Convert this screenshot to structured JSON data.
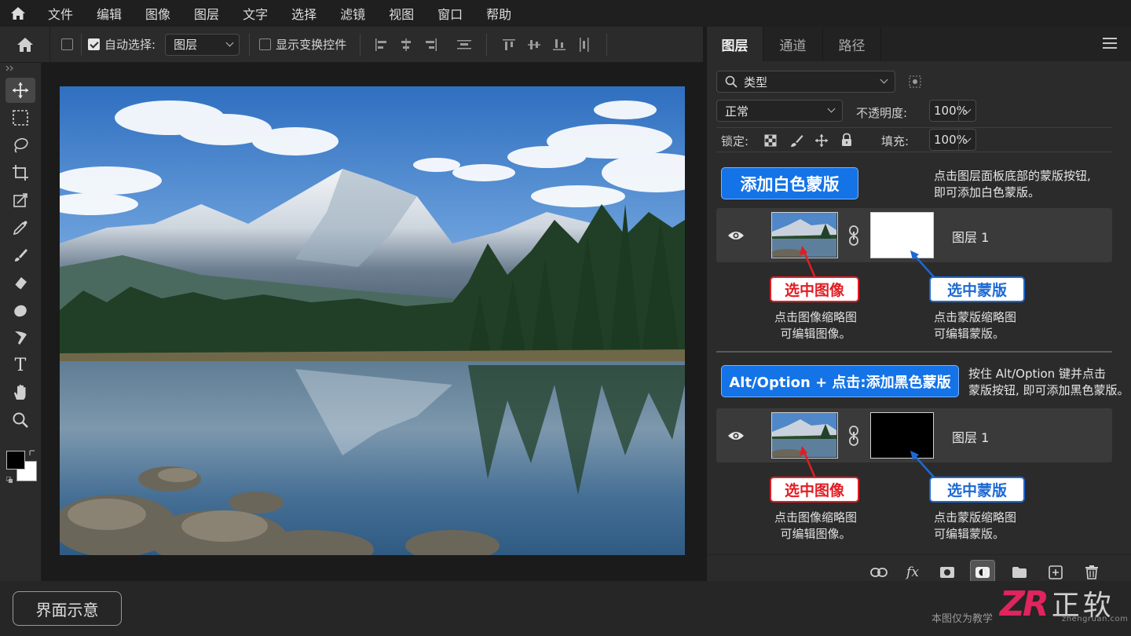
{
  "menu": {
    "items": [
      "文件",
      "编辑",
      "图像",
      "图层",
      "文字",
      "选择",
      "滤镜",
      "视图",
      "窗口",
      "帮助"
    ]
  },
  "options": {
    "auto_select_label": "自动选择:",
    "auto_select_checked": true,
    "target_value": "图层",
    "show_transform_label": "显示变换控件",
    "show_transform_checked": false
  },
  "tools": [
    "move-tool",
    "marquee-tool",
    "lasso-tool",
    "crop-tool",
    "frame-tool",
    "eyedropper-tool",
    "brush-tool",
    "eraser-tool",
    "dodge-tool",
    "pen-tool",
    "type-tool",
    "hand-tool",
    "zoom-tool"
  ],
  "type_tool_glyph": "T",
  "panel": {
    "tabs": [
      "图层",
      "通道",
      "路径"
    ],
    "active_tab": "图层",
    "filter_value": "类型",
    "blend_mode": "正常",
    "opacity_label": "不透明度:",
    "opacity_value": "100%",
    "lock_label": "锁定:",
    "fill_label": "填充:",
    "fill_value": "100%"
  },
  "sections": [
    {
      "banner": "添加白色蒙版",
      "note_line1": "点击图层面板底部的蒙版按钮,",
      "note_line2": "即可添加白色蒙版。",
      "layer_name": "图层 1",
      "mask_color": "#ffffff",
      "tag_image": "选中图像",
      "tag_mask": "选中蒙版",
      "caption_image_1": "点击图像缩略图",
      "caption_image_2": "可编辑图像。",
      "caption_mask_1": "点击蒙版缩略图",
      "caption_mask_2": "可编辑蒙版。"
    },
    {
      "banner": "Alt/Option + 点击:添加黑色蒙版",
      "note_line1": "按住 Alt/Option 键并点击",
      "note_line2": "蒙版按钮, 即可添加黑色蒙版。",
      "layer_name": "图层 1",
      "mask_color": "#000000",
      "tag_image": "选中图像",
      "tag_mask": "选中蒙版",
      "caption_image_1": "点击图像缩略图",
      "caption_image_2": "可编辑图像。",
      "caption_mask_1": "点击蒙版缩略图",
      "caption_mask_2": "可编辑蒙版。"
    }
  ],
  "footer_icons": [
    "link-icon",
    "fx-icon",
    "add-mask-icon",
    "adjustment-layer-icon",
    "folder-icon",
    "new-layer-icon",
    "trash-icon"
  ],
  "fx_label": "fx",
  "bottom": {
    "hint_button": "界面示意",
    "footnote": "本图仅为教学",
    "watermark_letters": "ZR",
    "watermark_text": "正软",
    "watermark_url": "zhengruan.com"
  },
  "colors": {
    "accent_blue": "#1473e6",
    "tag_red": "#e21d24",
    "tag_blue": "#1c69d4"
  }
}
